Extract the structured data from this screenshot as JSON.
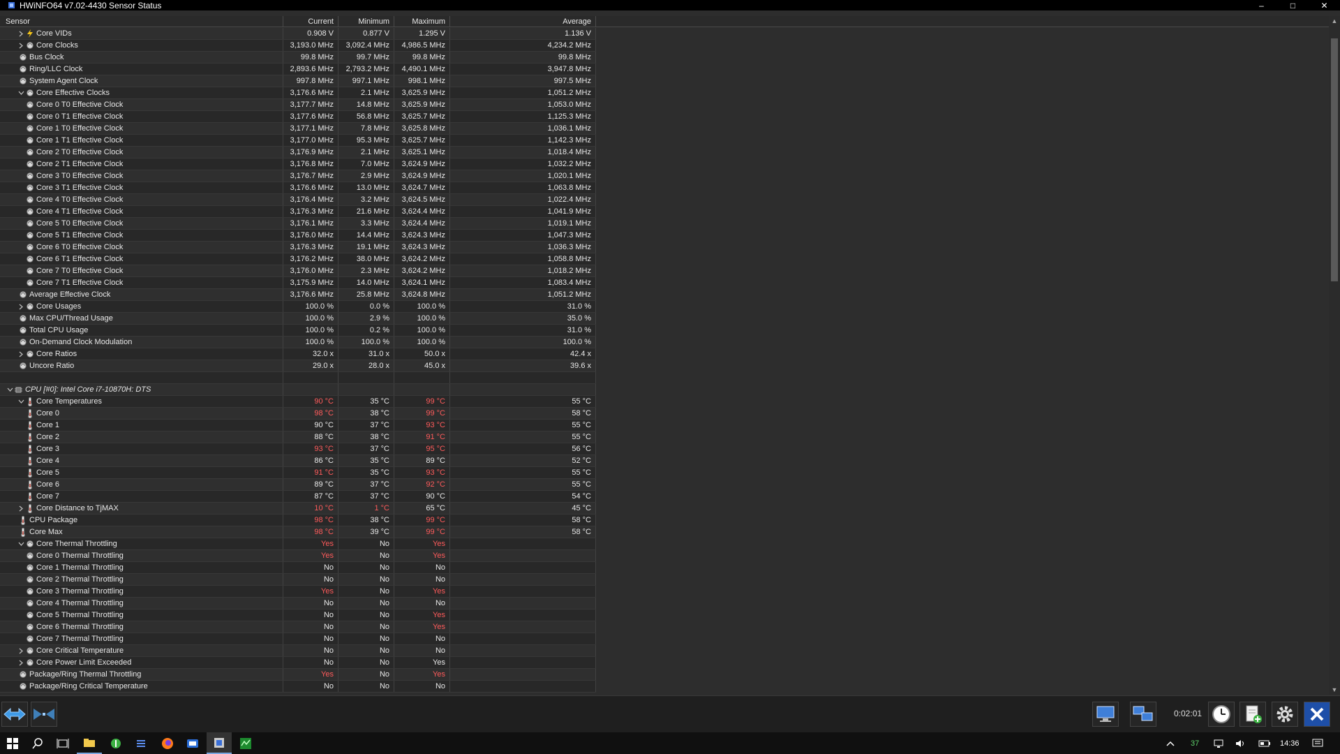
{
  "window": {
    "title": "HWiNFO64 v7.02-4430 Sensor Status"
  },
  "columns": {
    "sensor": "Sensor",
    "current": "Current",
    "minimum": "Minimum",
    "maximum": "Maximum",
    "average": "Average"
  },
  "rows": [
    {
      "name": "Core VIDs",
      "indent": 1,
      "expander": ">",
      "icon": "bolt",
      "cur": "0.908 V",
      "min": "0.877 V",
      "max": "1.295 V",
      "avg": "1.136 V"
    },
    {
      "name": "Core Clocks",
      "indent": 1,
      "expander": ">",
      "icon": "circle",
      "cur": "3,193.0 MHz",
      "min": "3,092.4 MHz",
      "max": "4,986.5 MHz",
      "avg": "4,234.2 MHz"
    },
    {
      "name": "Bus Clock",
      "indent": 0,
      "expander": "",
      "icon": "circle",
      "cur": "99.8 MHz",
      "min": "99.7 MHz",
      "max": "99.8 MHz",
      "avg": "99.8 MHz"
    },
    {
      "name": "Ring/LLC Clock",
      "indent": 0,
      "expander": "",
      "icon": "circle",
      "cur": "2,893.6 MHz",
      "min": "2,793.2 MHz",
      "max": "4,490.1 MHz",
      "avg": "3,947.8 MHz"
    },
    {
      "name": "System Agent Clock",
      "indent": 0,
      "expander": "",
      "icon": "circle",
      "cur": "997.8 MHz",
      "min": "997.1 MHz",
      "max": "998.1 MHz",
      "avg": "997.5 MHz"
    },
    {
      "name": "Core Effective Clocks",
      "indent": 1,
      "expander": "v",
      "icon": "circle",
      "cur": "3,176.6 MHz",
      "min": "2.1 MHz",
      "max": "3,625.9 MHz",
      "avg": "1,051.2 MHz"
    },
    {
      "name": "Core 0 T0 Effective Clock",
      "indent": 2,
      "expander": "",
      "icon": "circle",
      "cur": "3,177.7 MHz",
      "min": "14.8 MHz",
      "max": "3,625.9 MHz",
      "avg": "1,053.0 MHz"
    },
    {
      "name": "Core 0 T1 Effective Clock",
      "indent": 2,
      "expander": "",
      "icon": "circle",
      "cur": "3,177.6 MHz",
      "min": "56.8 MHz",
      "max": "3,625.7 MHz",
      "avg": "1,125.3 MHz"
    },
    {
      "name": "Core 1 T0 Effective Clock",
      "indent": 2,
      "expander": "",
      "icon": "circle",
      "cur": "3,177.1 MHz",
      "min": "7.8 MHz",
      "max": "3,625.8 MHz",
      "avg": "1,036.1 MHz"
    },
    {
      "name": "Core 1 T1 Effective Clock",
      "indent": 2,
      "expander": "",
      "icon": "circle",
      "cur": "3,177.0 MHz",
      "min": "95.3 MHz",
      "max": "3,625.7 MHz",
      "avg": "1,142.3 MHz"
    },
    {
      "name": "Core 2 T0 Effective Clock",
      "indent": 2,
      "expander": "",
      "icon": "circle",
      "cur": "3,176.9 MHz",
      "min": "2.1 MHz",
      "max": "3,625.1 MHz",
      "avg": "1,018.4 MHz"
    },
    {
      "name": "Core 2 T1 Effective Clock",
      "indent": 2,
      "expander": "",
      "icon": "circle",
      "cur": "3,176.8 MHz",
      "min": "7.0 MHz",
      "max": "3,624.9 MHz",
      "avg": "1,032.2 MHz"
    },
    {
      "name": "Core 3 T0 Effective Clock",
      "indent": 2,
      "expander": "",
      "icon": "circle",
      "cur": "3,176.7 MHz",
      "min": "2.9 MHz",
      "max": "3,624.9 MHz",
      "avg": "1,020.1 MHz"
    },
    {
      "name": "Core 3 T1 Effective Clock",
      "indent": 2,
      "expander": "",
      "icon": "circle",
      "cur": "3,176.6 MHz",
      "min": "13.0 MHz",
      "max": "3,624.7 MHz",
      "avg": "1,063.8 MHz"
    },
    {
      "name": "Core 4 T0 Effective Clock",
      "indent": 2,
      "expander": "",
      "icon": "circle",
      "cur": "3,176.4 MHz",
      "min": "3.2 MHz",
      "max": "3,624.5 MHz",
      "avg": "1,022.4 MHz"
    },
    {
      "name": "Core 4 T1 Effective Clock",
      "indent": 2,
      "expander": "",
      "icon": "circle",
      "cur": "3,176.3 MHz",
      "min": "21.6 MHz",
      "max": "3,624.4 MHz",
      "avg": "1,041.9 MHz"
    },
    {
      "name": "Core 5 T0 Effective Clock",
      "indent": 2,
      "expander": "",
      "icon": "circle",
      "cur": "3,176.1 MHz",
      "min": "3.3 MHz",
      "max": "3,624.4 MHz",
      "avg": "1,019.1 MHz"
    },
    {
      "name": "Core 5 T1 Effective Clock",
      "indent": 2,
      "expander": "",
      "icon": "circle",
      "cur": "3,176.0 MHz",
      "min": "14.4 MHz",
      "max": "3,624.3 MHz",
      "avg": "1,047.3 MHz"
    },
    {
      "name": "Core 6 T0 Effective Clock",
      "indent": 2,
      "expander": "",
      "icon": "circle",
      "cur": "3,176.3 MHz",
      "min": "19.1 MHz",
      "max": "3,624.3 MHz",
      "avg": "1,036.3 MHz"
    },
    {
      "name": "Core 6 T1 Effective Clock",
      "indent": 2,
      "expander": "",
      "icon": "circle",
      "cur": "3,176.2 MHz",
      "min": "38.0 MHz",
      "max": "3,624.2 MHz",
      "avg": "1,058.8 MHz"
    },
    {
      "name": "Core 7 T0 Effective Clock",
      "indent": 2,
      "expander": "",
      "icon": "circle",
      "cur": "3,176.0 MHz",
      "min": "2.3 MHz",
      "max": "3,624.2 MHz",
      "avg": "1,018.2 MHz"
    },
    {
      "name": "Core 7 T1 Effective Clock",
      "indent": 2,
      "expander": "",
      "icon": "circle",
      "cur": "3,175.9 MHz",
      "min": "14.0 MHz",
      "max": "3,624.1 MHz",
      "avg": "1,083.4 MHz"
    },
    {
      "name": "Average Effective Clock",
      "indent": 0,
      "expander": "",
      "icon": "circle",
      "cur": "3,176.6 MHz",
      "min": "25.8 MHz",
      "max": "3,624.8 MHz",
      "avg": "1,051.2 MHz"
    },
    {
      "name": "Core Usages",
      "indent": 1,
      "expander": ">",
      "icon": "circle",
      "cur": "100.0 %",
      "min": "0.0 %",
      "max": "100.0 %",
      "avg": "31.0 %"
    },
    {
      "name": "Max CPU/Thread Usage",
      "indent": 0,
      "expander": "",
      "icon": "circle",
      "cur": "100.0 %",
      "min": "2.9 %",
      "max": "100.0 %",
      "avg": "35.0 %"
    },
    {
      "name": "Total CPU Usage",
      "indent": 0,
      "expander": "",
      "icon": "circle",
      "cur": "100.0 %",
      "min": "0.2 %",
      "max": "100.0 %",
      "avg": "31.0 %"
    },
    {
      "name": "On-Demand Clock Modulation",
      "indent": 0,
      "expander": "",
      "icon": "circle",
      "cur": "100.0 %",
      "min": "100.0 %",
      "max": "100.0 %",
      "avg": "100.0 %"
    },
    {
      "name": "Core Ratios",
      "indent": 1,
      "expander": ">",
      "icon": "circle",
      "cur": "32.0 x",
      "min": "31.0 x",
      "max": "50.0 x",
      "avg": "42.4 x"
    },
    {
      "name": "Uncore Ratio",
      "indent": 0,
      "expander": "",
      "icon": "circle",
      "cur": "29.0 x",
      "min": "28.0 x",
      "max": "45.0 x",
      "avg": "39.6 x"
    },
    {
      "name": "",
      "indent": 0,
      "expander": "",
      "icon": "",
      "cur": "",
      "min": "",
      "max": "",
      "avg": ""
    },
    {
      "name": "CPU [#0]: Intel Core i7-10870H: DTS",
      "indent": 0,
      "group": true,
      "expander": "v",
      "icon": "chip",
      "cur": "",
      "min": "",
      "max": "",
      "avg": ""
    },
    {
      "name": "Core Temperatures",
      "indent": 1,
      "expander": "v",
      "icon": "thermo",
      "cur": "90 °C",
      "min": "35 °C",
      "max": "99 °C",
      "avg": "55 °C",
      "red": [
        "cur",
        "max"
      ]
    },
    {
      "name": "Core 0",
      "indent": 2,
      "expander": "",
      "icon": "thermo",
      "cur": "98 °C",
      "min": "38 °C",
      "max": "99 °C",
      "avg": "58 °C",
      "red": [
        "cur",
        "max"
      ]
    },
    {
      "name": "Core 1",
      "indent": 2,
      "expander": "",
      "icon": "thermo",
      "cur": "90 °C",
      "min": "37 °C",
      "max": "93 °C",
      "avg": "55 °C",
      "red": [
        "max"
      ]
    },
    {
      "name": "Core 2",
      "indent": 2,
      "expander": "",
      "icon": "thermo",
      "cur": "88 °C",
      "min": "38 °C",
      "max": "91 °C",
      "avg": "55 °C",
      "red": [
        "max"
      ]
    },
    {
      "name": "Core 3",
      "indent": 2,
      "expander": "",
      "icon": "thermo",
      "cur": "93 °C",
      "min": "37 °C",
      "max": "95 °C",
      "avg": "56 °C",
      "red": [
        "cur",
        "max"
      ]
    },
    {
      "name": "Core 4",
      "indent": 2,
      "expander": "",
      "icon": "thermo",
      "cur": "86 °C",
      "min": "35 °C",
      "max": "89 °C",
      "avg": "52 °C"
    },
    {
      "name": "Core 5",
      "indent": 2,
      "expander": "",
      "icon": "thermo",
      "cur": "91 °C",
      "min": "35 °C",
      "max": "93 °C",
      "avg": "55 °C",
      "red": [
        "cur",
        "max"
      ]
    },
    {
      "name": "Core 6",
      "indent": 2,
      "expander": "",
      "icon": "thermo",
      "cur": "89 °C",
      "min": "37 °C",
      "max": "92 °C",
      "avg": "55 °C",
      "red": [
        "max"
      ]
    },
    {
      "name": "Core 7",
      "indent": 2,
      "expander": "",
      "icon": "thermo",
      "cur": "87 °C",
      "min": "37 °C",
      "max": "90 °C",
      "avg": "54 °C"
    },
    {
      "name": "Core Distance to TjMAX",
      "indent": 1,
      "expander": ">",
      "icon": "thermo",
      "cur": "10 °C",
      "min": "1 °C",
      "max": "65 °C",
      "avg": "45 °C",
      "red": [
        "cur",
        "min"
      ]
    },
    {
      "name": "CPU Package",
      "indent": 0,
      "expander": "",
      "icon": "thermo",
      "cur": "98 °C",
      "min": "38 °C",
      "max": "99 °C",
      "avg": "58 °C",
      "red": [
        "cur",
        "max"
      ]
    },
    {
      "name": "Core Max",
      "indent": 0,
      "expander": "",
      "icon": "thermo",
      "cur": "98 °C",
      "min": "39 °C",
      "max": "99 °C",
      "avg": "58 °C",
      "red": [
        "cur",
        "max"
      ]
    },
    {
      "name": "Core Thermal Throttling",
      "indent": 1,
      "expander": "v",
      "icon": "circle",
      "cur": "Yes",
      "min": "No",
      "max": "Yes",
      "avg": "",
      "red": [
        "cur",
        "max"
      ]
    },
    {
      "name": "Core 0 Thermal Throttling",
      "indent": 2,
      "expander": "",
      "icon": "circle",
      "cur": "Yes",
      "min": "No",
      "max": "Yes",
      "avg": "",
      "red": [
        "cur",
        "max"
      ]
    },
    {
      "name": "Core 1 Thermal Throttling",
      "indent": 2,
      "expander": "",
      "icon": "circle",
      "cur": "No",
      "min": "No",
      "max": "No",
      "avg": ""
    },
    {
      "name": "Core 2 Thermal Throttling",
      "indent": 2,
      "expander": "",
      "icon": "circle",
      "cur": "No",
      "min": "No",
      "max": "No",
      "avg": ""
    },
    {
      "name": "Core 3 Thermal Throttling",
      "indent": 2,
      "expander": "",
      "icon": "circle",
      "cur": "Yes",
      "min": "No",
      "max": "Yes",
      "avg": "",
      "red": [
        "cur",
        "max"
      ]
    },
    {
      "name": "Core 4 Thermal Throttling",
      "indent": 2,
      "expander": "",
      "icon": "circle",
      "cur": "No",
      "min": "No",
      "max": "No",
      "avg": ""
    },
    {
      "name": "Core 5 Thermal Throttling",
      "indent": 2,
      "expander": "",
      "icon": "circle",
      "cur": "No",
      "min": "No",
      "max": "Yes",
      "avg": "",
      "red": [
        "max"
      ]
    },
    {
      "name": "Core 6 Thermal Throttling",
      "indent": 2,
      "expander": "",
      "icon": "circle",
      "cur": "No",
      "min": "No",
      "max": "Yes",
      "avg": "",
      "red": [
        "max"
      ]
    },
    {
      "name": "Core 7 Thermal Throttling",
      "indent": 2,
      "expander": "",
      "icon": "circle",
      "cur": "No",
      "min": "No",
      "max": "No",
      "avg": ""
    },
    {
      "name": "Core Critical Temperature",
      "indent": 1,
      "expander": ">",
      "icon": "circle",
      "cur": "No",
      "min": "No",
      "max": "No",
      "avg": ""
    },
    {
      "name": "Core Power Limit Exceeded",
      "indent": 1,
      "expander": ">",
      "icon": "circle",
      "cur": "No",
      "min": "No",
      "max": "Yes",
      "avg": ""
    },
    {
      "name": "Package/Ring Thermal Throttling",
      "indent": 0,
      "expander": "",
      "icon": "circle",
      "cur": "Yes",
      "min": "No",
      "max": "Yes",
      "avg": "",
      "red": [
        "cur",
        "max"
      ]
    },
    {
      "name": "Package/Ring Critical Temperature",
      "indent": 0,
      "expander": "",
      "icon": "circle",
      "cur": "No",
      "min": "No",
      "max": "No",
      "avg": ""
    }
  ],
  "footer": {
    "timer": "0:02:01"
  },
  "taskbar": {
    "tray_number": "37",
    "clock": "14:36"
  },
  "colors": {
    "alert": "#ff5b5b",
    "accent": "#1e90ff",
    "bg": "#2d2d2d"
  }
}
